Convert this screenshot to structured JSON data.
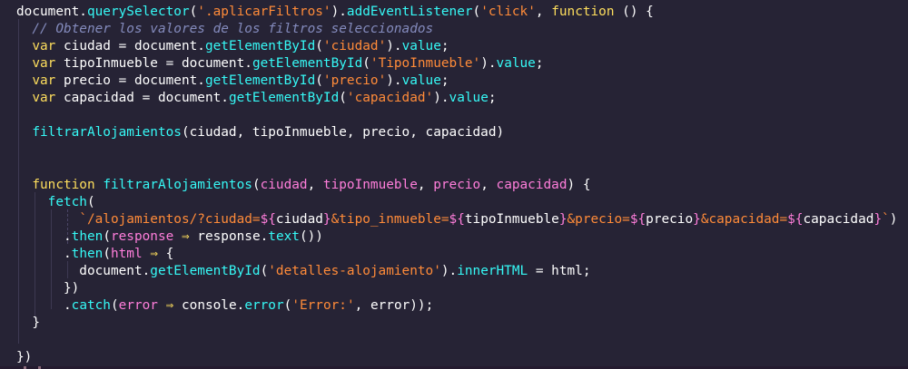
{
  "editor": {
    "language": "javascript",
    "theme_colors": {
      "background": "#262335",
      "keyword": "#fede5d",
      "function": "#36f9f6",
      "string": "#ff8b39",
      "comment": "#848bbd",
      "parameter": "#ff7edb",
      "plain": "#ffffff"
    },
    "lines": [
      [
        [
          "plain",
          "document."
        ],
        [
          "fn",
          "querySelector"
        ],
        [
          "plain",
          "("
        ],
        [
          "str",
          "'.aplicarFiltros'"
        ],
        [
          "plain",
          ")."
        ],
        [
          "fn",
          "addEventListener"
        ],
        [
          "plain",
          "("
        ],
        [
          "str",
          "'click'"
        ],
        [
          "plain",
          ", "
        ],
        [
          "kw",
          "function"
        ],
        [
          "plain",
          " () {"
        ]
      ],
      [
        [
          "plain",
          "  "
        ],
        [
          "cm",
          "// Obtener los valores de los filtros seleccionados"
        ]
      ],
      [
        [
          "plain",
          "  "
        ],
        [
          "kw",
          "var"
        ],
        [
          "plain",
          " ciudad = document."
        ],
        [
          "fn",
          "getElementById"
        ],
        [
          "plain",
          "("
        ],
        [
          "str",
          "'ciudad'"
        ],
        [
          "plain",
          ")."
        ],
        [
          "mth",
          "value"
        ],
        [
          "plain",
          ";"
        ]
      ],
      [
        [
          "plain",
          "  "
        ],
        [
          "kw",
          "var"
        ],
        [
          "plain",
          " tipoInmueble = document."
        ],
        [
          "fn",
          "getElementById"
        ],
        [
          "plain",
          "("
        ],
        [
          "str",
          "'TipoInmueble'"
        ],
        [
          "plain",
          ")."
        ],
        [
          "mth",
          "value"
        ],
        [
          "plain",
          ";"
        ]
      ],
      [
        [
          "plain",
          "  "
        ],
        [
          "kw",
          "var"
        ],
        [
          "plain",
          " precio = document."
        ],
        [
          "fn",
          "getElementById"
        ],
        [
          "plain",
          "("
        ],
        [
          "str",
          "'precio'"
        ],
        [
          "plain",
          ")."
        ],
        [
          "mth",
          "value"
        ],
        [
          "plain",
          ";"
        ]
      ],
      [
        [
          "plain",
          "  "
        ],
        [
          "kw",
          "var"
        ],
        [
          "plain",
          " capacidad = document."
        ],
        [
          "fn",
          "getElementById"
        ],
        [
          "plain",
          "("
        ],
        [
          "str",
          "'capacidad'"
        ],
        [
          "plain",
          ")."
        ],
        [
          "mth",
          "value"
        ],
        [
          "plain",
          ";"
        ]
      ],
      [],
      [
        [
          "plain",
          "  "
        ],
        [
          "fn",
          "filtrarAlojamientos"
        ],
        [
          "plain",
          "(ciudad, tipoInmueble, precio, capacidad)"
        ]
      ],
      [],
      [],
      [
        [
          "plain",
          "  "
        ],
        [
          "kw",
          "function"
        ],
        [
          "plain",
          " "
        ],
        [
          "fn",
          "filtrarAlojamientos"
        ],
        [
          "plain",
          "("
        ],
        [
          "prm",
          "ciudad"
        ],
        [
          "plain",
          ", "
        ],
        [
          "prm",
          "tipoInmueble"
        ],
        [
          "plain",
          ", "
        ],
        [
          "prm",
          "precio"
        ],
        [
          "plain",
          ", "
        ],
        [
          "prm",
          "capacidad"
        ],
        [
          "plain",
          ") {"
        ]
      ],
      [
        [
          "plain",
          "    "
        ],
        [
          "fn",
          "fetch"
        ],
        [
          "plain",
          "("
        ]
      ],
      [
        [
          "plain",
          "        "
        ],
        [
          "tpl",
          "`/alojamientos/?ciudad="
        ],
        [
          "var",
          "${"
        ],
        [
          "plain",
          "ciudad"
        ],
        [
          "var",
          "}"
        ],
        [
          "tpl",
          "&tipo_inmueble="
        ],
        [
          "var",
          "${"
        ],
        [
          "plain",
          "tipoInmueble"
        ],
        [
          "var",
          "}"
        ],
        [
          "tpl",
          "&precio="
        ],
        [
          "var",
          "${"
        ],
        [
          "plain",
          "precio"
        ],
        [
          "var",
          "}"
        ],
        [
          "tpl",
          "&capacidad="
        ],
        [
          "var",
          "${"
        ],
        [
          "plain",
          "capacidad"
        ],
        [
          "var",
          "}"
        ],
        [
          "tpl",
          "`"
        ],
        [
          "plain",
          ")"
        ]
      ],
      [
        [
          "plain",
          "      ."
        ],
        [
          "fn",
          "then"
        ],
        [
          "plain",
          "("
        ],
        [
          "prm",
          "response"
        ],
        [
          "plain",
          " "
        ],
        [
          "op",
          "⇒"
        ],
        [
          "plain",
          " response."
        ],
        [
          "fn",
          "text"
        ],
        [
          "plain",
          "())"
        ]
      ],
      [
        [
          "plain",
          "      ."
        ],
        [
          "fn",
          "then"
        ],
        [
          "plain",
          "("
        ],
        [
          "prm",
          "html"
        ],
        [
          "plain",
          " "
        ],
        [
          "op",
          "⇒"
        ],
        [
          "plain",
          " {"
        ]
      ],
      [
        [
          "plain",
          "        document."
        ],
        [
          "fn",
          "getElementById"
        ],
        [
          "plain",
          "("
        ],
        [
          "str",
          "'detalles-alojamiento'"
        ],
        [
          "plain",
          ")."
        ],
        [
          "mth",
          "innerHTML"
        ],
        [
          "plain",
          " = html;"
        ]
      ],
      [
        [
          "plain",
          "      })"
        ]
      ],
      [
        [
          "plain",
          "      ."
        ],
        [
          "fn",
          "catch"
        ],
        [
          "plain",
          "("
        ],
        [
          "prm",
          "error"
        ],
        [
          "plain",
          " "
        ],
        [
          "op",
          "⇒"
        ],
        [
          "plain",
          " console."
        ],
        [
          "fn",
          "error"
        ],
        [
          "plain",
          "("
        ],
        [
          "str",
          "'Error:'"
        ],
        [
          "plain",
          ", error));"
        ]
      ],
      [
        [
          "plain",
          "  }"
        ]
      ],
      [],
      [
        [
          "plain",
          "})"
        ]
      ]
    ]
  }
}
